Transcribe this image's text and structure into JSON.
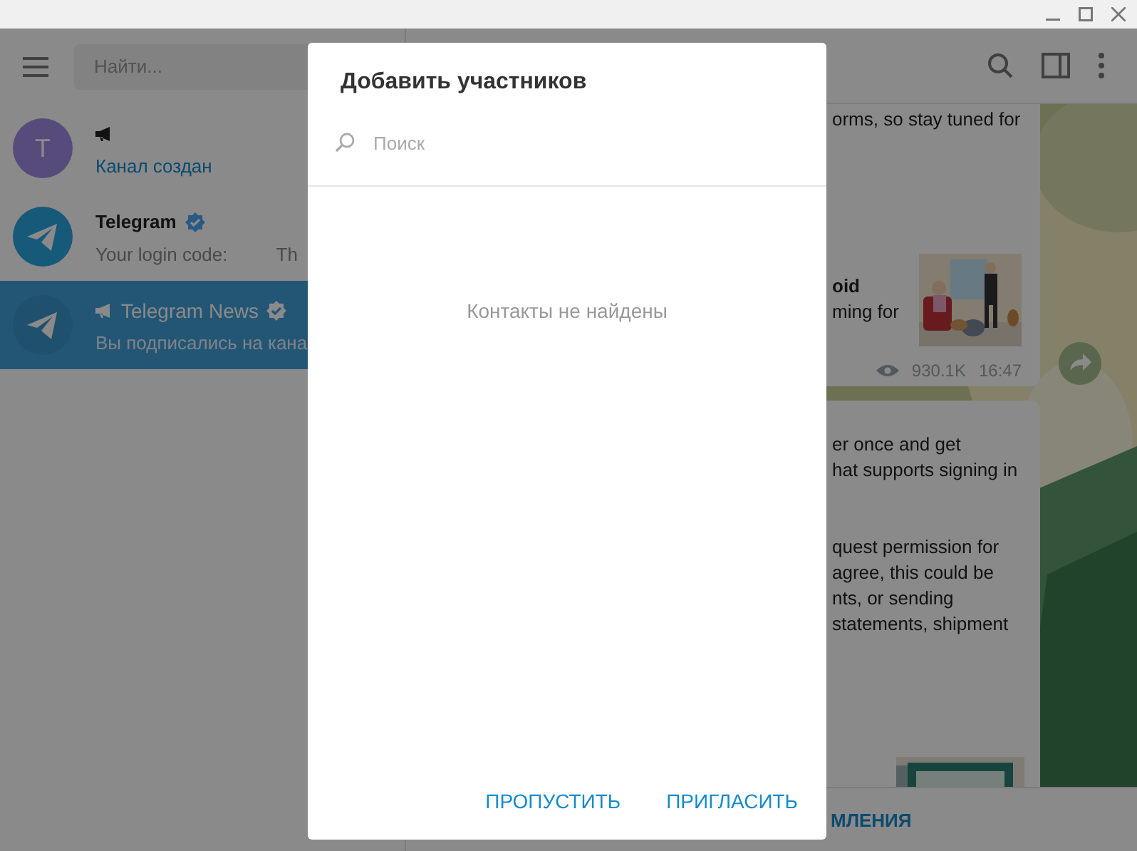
{
  "sidebar": {
    "search": {
      "placeholder": "Найти..."
    },
    "chats": [
      {
        "kind": "letter",
        "avatar": "T",
        "channel": true,
        "verified": false,
        "preview": "Канал создан",
        "service": true,
        "selected": false
      },
      {
        "kind": "logo",
        "name": "Telegram",
        "channel": false,
        "verified": true,
        "preview": "Your login code:",
        "preview_tail": "Th",
        "service": false,
        "selected": false
      },
      {
        "kind": "logo",
        "name": "Telegram News",
        "channel": true,
        "verified": true,
        "preview": "Вы подписались на кана",
        "service": false,
        "selected": true
      }
    ]
  },
  "chat": {
    "messages": [
      {
        "lines": [
          "orms, so stay tuned for"
        ],
        "preview": {
          "title": "oid",
          "description": "ming for"
        },
        "views": "930.1K",
        "time": "16:47"
      },
      {
        "paragraphs": [
          [
            "er once and get",
            "hat supports signing in"
          ],
          [
            "quest permission for",
            "agree, this could be",
            "nts, or sending",
            "statements, shipment"
          ]
        ]
      }
    ],
    "bottom_action": "МЛЕНИЯ"
  },
  "dialog": {
    "title": "Добавить участников",
    "search": {
      "placeholder": "Поиск"
    },
    "empty_text": "Контакты не найдены",
    "buttons": [
      "ПРОПУСТИТЬ",
      "ПРИГЛАСИТЬ"
    ]
  }
}
